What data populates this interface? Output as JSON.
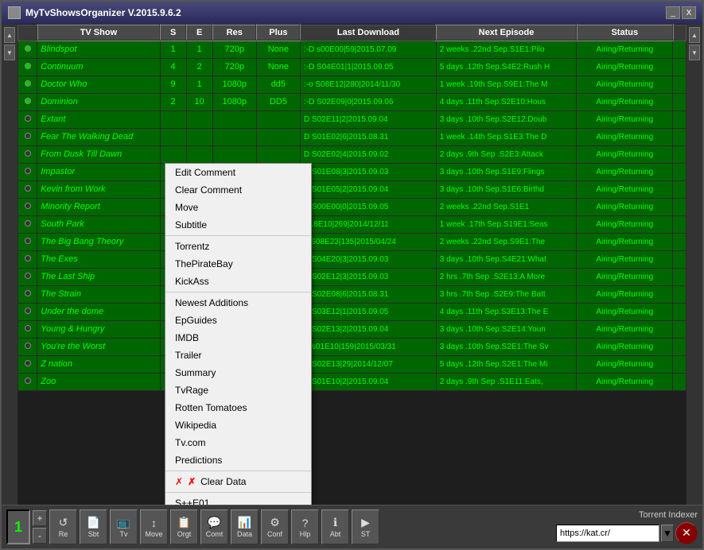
{
  "window": {
    "title": "MyTvShowsOrganizer V.2015.9.6.2",
    "controls": [
      "_",
      "X"
    ]
  },
  "table": {
    "columns": [
      "",
      "TV Show",
      "S",
      "E",
      "Res",
      "Plus",
      "Last Download",
      "Next Episode",
      "Status",
      ""
    ],
    "rows": [
      {
        "indicator": "",
        "show": "Blindspot",
        "s": "1",
        "e": "1",
        "res": "720p",
        "plus": "None",
        "last": ":-D s00E00|59|2015.07.09",
        "next": "2 weeks .22nd Sep.S1E1:Pilo",
        "status": "Airing/Returning"
      },
      {
        "indicator": "",
        "show": "Continuum",
        "s": "4",
        "e": "2",
        "res": "720p",
        "plus": "None",
        "last": ":-D S04E01|1|2015.09.05",
        "next": "5 days .12th Sep.S4E2:Rush H",
        "status": "Airing/Returning"
      },
      {
        "indicator": "",
        "show": "Doctor Who",
        "s": "9",
        "e": "1",
        "res": "1080p",
        "plus": "dd5",
        "last": ":-o S08E12|280|2014/11/30",
        "next": "1 week .19th Sep.S9E1:The M",
        "status": "Airing/Returning"
      },
      {
        "indicator": "",
        "show": "Dominion",
        "s": "2",
        "e": "10",
        "res": "1080p",
        "plus": "DD5",
        "last": ":-D S02E09|0|2015.09.06",
        "next": "4 days .11th Sep.S2E10:Hous",
        "status": "Airing/Returning"
      },
      {
        "indicator": "",
        "show": "Extant",
        "s": "",
        "e": "",
        "res": "",
        "plus": "",
        "last": "D S02E11|2|2015.09.04",
        "next": "3 days .10th Sep.S2E12:Doub",
        "status": "Airing/Returning"
      },
      {
        "indicator": "",
        "show": "Fear The Walking Dead",
        "s": "",
        "e": "",
        "res": "",
        "plus": "",
        "last": "D S01E02|6|2015.08.31",
        "next": "1 week .14th Sep.S1E3:The D",
        "status": "Airing/Returning"
      },
      {
        "indicator": "",
        "show": "From Dusk Till Dawn",
        "s": "",
        "e": "",
        "res": "",
        "plus": "",
        "last": "D S02E02|4|2015.09.02",
        "next": "2 days .9th Sep .S2E3:Attack",
        "status": "Airing/Returning"
      },
      {
        "indicator": "",
        "show": "Impastor",
        "s": "",
        "e": "",
        "res": "",
        "plus": "",
        "last": "D S01E08|3|2015.09.03",
        "next": "3 days .10th Sep.S1E9:Flings",
        "status": "Airing/Returning"
      },
      {
        "indicator": "",
        "show": "Kevin from Work",
        "s": "",
        "e": "",
        "res": "",
        "plus": "",
        "last": "D S01E05|2|2015.09.04",
        "next": "3 days .10th Sep.S1E6:Birthd",
        "status": "Airing/Returning"
      },
      {
        "indicator": "",
        "show": "Minority Report",
        "s": "",
        "e": "",
        "res": "",
        "plus": "",
        "last": "D S00E00|0|2015.09.05",
        "next": "2 weeks .22nd Sep.S1E1",
        "status": "Airing/Returning"
      },
      {
        "indicator": "",
        "show": "South Park",
        "s": "",
        "e": "",
        "res": "",
        "plus": "",
        "last": "S18E10|269|2014/12/11",
        "next": "1 week .17th Sep.S19E1:Seas",
        "status": "Airing/Returning"
      },
      {
        "indicator": "",
        "show": "The Big Bang Theory",
        "s": "",
        "e": "",
        "res": "",
        "plus": "",
        "last": "o S08E23|135|2015/04/24",
        "next": "2 weeks .22nd Sep.S9E1:The",
        "status": "Airing/Returning"
      },
      {
        "indicator": "",
        "show": "The Exes",
        "s": "",
        "e": "",
        "res": "",
        "plus": "",
        "last": "D S04E20|3|2015.09.03",
        "next": "3 days .10th Sep.S4E21:What",
        "status": "Airing/Returning"
      },
      {
        "indicator": "",
        "show": "The Last Ship",
        "s": "",
        "e": "",
        "res": "",
        "plus": "",
        "last": "D S02E12|3|2015.09.03",
        "next": "2 hrs .7th Sep .S2E13:A More",
        "status": "Airing/Returning"
      },
      {
        "indicator": "",
        "show": "The Strain",
        "s": "",
        "e": "",
        "res": "",
        "plus": "",
        "last": "D S02E08|6|2015.08.31",
        "next": "3 hrs .7th Sep .S2E9:The Batt",
        "status": "Airing/Returning"
      },
      {
        "indicator": "",
        "show": "Under the dome",
        "s": "",
        "e": "",
        "res": "",
        "plus": "",
        "last": "D S03E12|1|2015.09.05",
        "next": "4 days .11th Sep.S3E13:The E",
        "status": "Airing/Returning"
      },
      {
        "indicator": "",
        "show": "Young & Hungry",
        "s": "",
        "e": "",
        "res": "",
        "plus": "",
        "last": "D S02E13|2|2015.09.04",
        "next": "3 days .10th Sep.S2E14:Youn",
        "status": "Airing/Returning"
      },
      {
        "indicator": "",
        "show": "You're the Worst",
        "s": "",
        "e": "",
        "res": "",
        "plus": "",
        "last": "D s01E10|159|2015/03/31",
        "next": "3 days .10th Sep.S2E1:The Sv",
        "status": "Airing/Returning"
      },
      {
        "indicator": "",
        "show": "Z nation",
        "s": "",
        "e": "",
        "res": "",
        "plus": "",
        "last": "D S02E13|29|2014/12/07",
        "next": "5 days .12th Sep.S2E1:The Mi",
        "status": "Airing/Returning"
      },
      {
        "indicator": "",
        "show": "Zoo",
        "s": "",
        "e": "",
        "res": "",
        "plus": "",
        "last": "D S01E10|2|2015.09.04",
        "next": "2 days .9th Sep .S1E11:Eats,",
        "status": "Airing/Returning"
      }
    ]
  },
  "context_menu": {
    "items": [
      {
        "label": "Edit Comment",
        "type": "item"
      },
      {
        "label": "Clear Comment",
        "type": "item"
      },
      {
        "label": "Move",
        "type": "item"
      },
      {
        "label": "Subtitle",
        "type": "item"
      },
      {
        "type": "separator"
      },
      {
        "label": "Torrentz",
        "type": "item"
      },
      {
        "label": "ThePirateBay",
        "type": "item"
      },
      {
        "label": "KickAss",
        "type": "item"
      },
      {
        "type": "separator"
      },
      {
        "label": "Newest Additions",
        "type": "item"
      },
      {
        "label": "EpGuides",
        "type": "item"
      },
      {
        "label": "IMDB",
        "type": "item"
      },
      {
        "label": "Trailer",
        "type": "item"
      },
      {
        "label": "Summary",
        "type": "item"
      },
      {
        "label": "TvRage",
        "type": "item"
      },
      {
        "label": "Rotten Tomatoes",
        "type": "item"
      },
      {
        "label": "Wikipedia",
        "type": "item"
      },
      {
        "label": "Tv.com",
        "type": "item"
      },
      {
        "label": "Predictions",
        "type": "item"
      },
      {
        "type": "separator"
      },
      {
        "label": "Clear Data",
        "type": "item-icon"
      },
      {
        "type": "separator"
      },
      {
        "label": "S++E01",
        "type": "item"
      }
    ]
  },
  "toolbar": {
    "page_num": "1",
    "plus_label": "+",
    "minus_label": "-",
    "buttons": [
      {
        "label": "Re",
        "icon": "↺"
      },
      {
        "label": "Sbt",
        "icon": "📄"
      },
      {
        "label": "Tv",
        "icon": "📺"
      },
      {
        "label": "Move",
        "icon": "↕"
      },
      {
        "label": "Orgt",
        "icon": "📋"
      },
      {
        "label": "Comt",
        "icon": "💬"
      },
      {
        "label": "Data",
        "icon": "📊"
      },
      {
        "label": "Conf",
        "icon": "⚙"
      },
      {
        "label": "Hlp",
        "icon": "?"
      },
      {
        "label": "Abt",
        "icon": "ℹ"
      },
      {
        "label": "ST",
        "icon": "▶"
      }
    ],
    "torrent_label": "Torrent Indexer",
    "torrent_url": "https://kat.cr/"
  },
  "colors": {
    "green_bg": "#006600",
    "green_text": "#00ff00",
    "dark_bg": "#1e1e1e",
    "header_bg": "#3a3a3a"
  }
}
